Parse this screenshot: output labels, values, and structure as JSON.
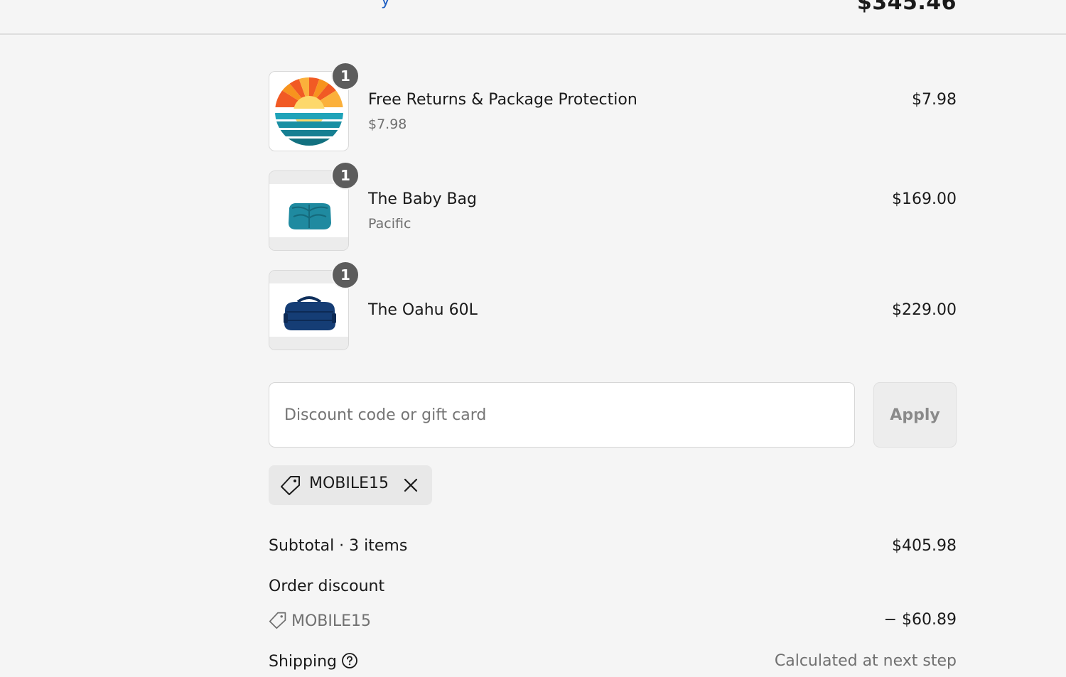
{
  "header": {
    "link_fragment": "y",
    "order_total": "$345.46"
  },
  "items": [
    {
      "quantity": "1",
      "name": "Free Returns & Package Protection",
      "subtitle": "$7.98",
      "price": "$7.98",
      "icon": "sunset-logo-icon"
    },
    {
      "quantity": "1",
      "name": "The Baby Bag",
      "subtitle": "Pacific",
      "price": "$169.00",
      "icon": "teal-bag-photo"
    },
    {
      "quantity": "1",
      "name": "The Oahu 60L",
      "subtitle": "",
      "price": "$229.00",
      "icon": "navy-duffel-photo"
    }
  ],
  "discount": {
    "placeholder": "Discount code or gift card",
    "apply_label": "Apply",
    "applied_code": "MOBILE15"
  },
  "summary": {
    "subtotal_label": "Subtotal · 3 items",
    "subtotal_value": "$405.98",
    "order_discount_label": "Order discount",
    "discount_code": "MOBILE15",
    "discount_value": "− $60.89",
    "shipping_label": "Shipping",
    "shipping_value": "Calculated at next step"
  },
  "colors": {
    "background": "#f5f5f5",
    "link": "#1f5fc2",
    "badge": "#5c5c5c",
    "muted_text": "#707070"
  }
}
